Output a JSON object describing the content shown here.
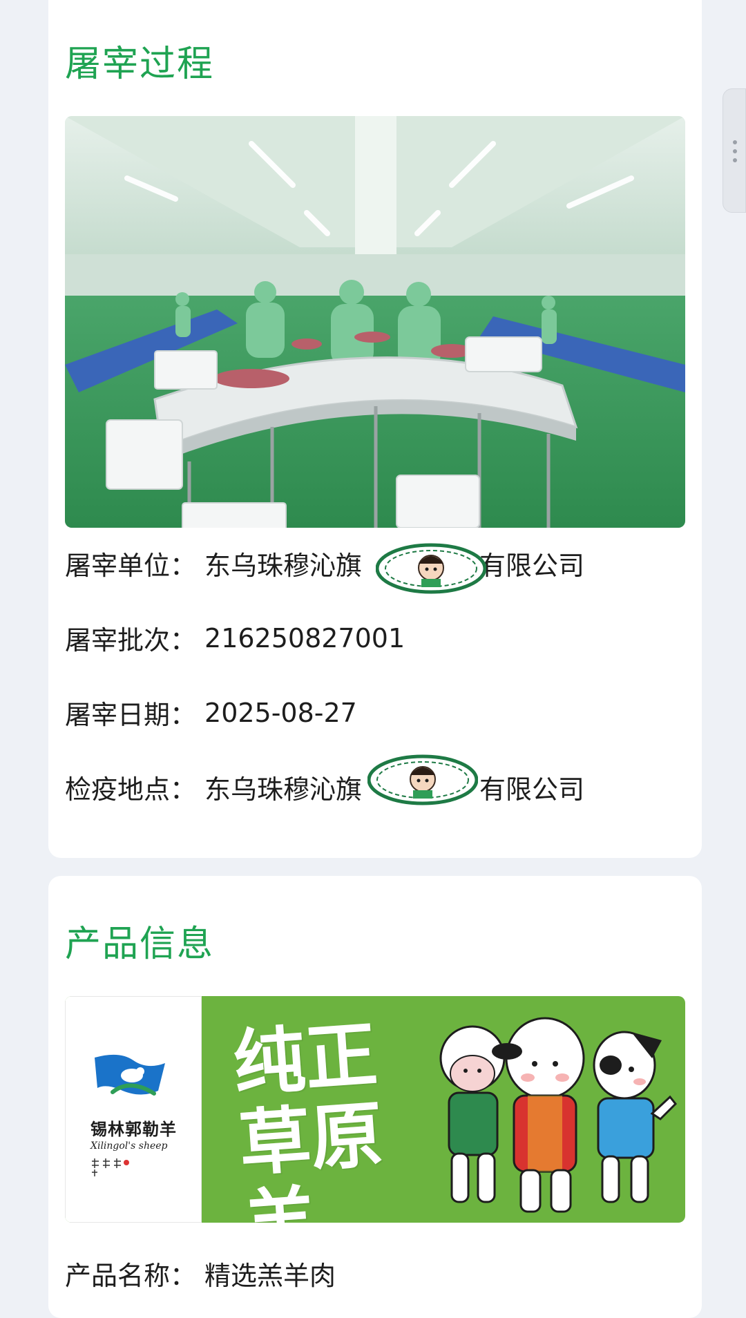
{
  "slaughter": {
    "title": "屠宰过程",
    "rows": [
      {
        "label": "屠宰单位：",
        "value": "东乌珠穆沁旗",
        "suffix": "有限公司"
      },
      {
        "label": "屠宰批次：",
        "value": "216250827001"
      },
      {
        "label": "屠宰日期：",
        "value": "2025-08-27"
      },
      {
        "label": "检疫地点：",
        "value": "东乌珠穆沁旗",
        "suffix": "有限公司"
      }
    ]
  },
  "product": {
    "title": "产品信息",
    "banner": {
      "brand_name": "锡林郭勒羊",
      "brand_en": "Xilingol's sheep",
      "slogan": "纯正\n草原羊"
    },
    "rows": [
      {
        "label": "产品名称：",
        "value": "精选羔羊肉"
      }
    ]
  },
  "colors": {
    "accent": "#1fa352",
    "banner_green": "#6cb33f",
    "background": "#eef1f6"
  },
  "icons": {
    "stamp": "mascot-stamp-icon",
    "brand": "sheep-logo-icon",
    "scroll": "drag-handle-icon"
  }
}
